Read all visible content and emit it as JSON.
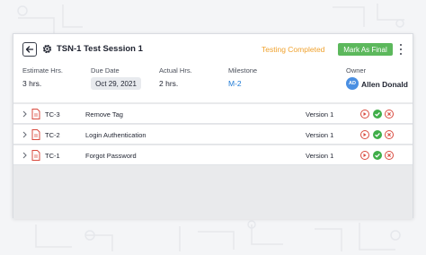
{
  "session": {
    "title": "TSN-1 Test Session 1",
    "status": "Testing Completed",
    "final_button": "Mark As Final"
  },
  "meta": {
    "estimate": {
      "label": "Estimate Hrs.",
      "value": "3 hrs."
    },
    "due": {
      "label": "Due Date",
      "value": "Oct 29, 2021"
    },
    "actual": {
      "label": "Actual Hrs.",
      "value": "2 hrs."
    },
    "milestone": {
      "label": "Milestone",
      "value": "M-2"
    },
    "owner": {
      "label": "Owner",
      "initials": "AD",
      "name": "Allen Donald"
    }
  },
  "test_cases": [
    {
      "id": "TC-3",
      "name": "Remove Tag",
      "version": "Version 1"
    },
    {
      "id": "TC-2",
      "name": "Login Authentication",
      "version": "Version 1"
    },
    {
      "id": "TC-1",
      "name": "Forgot Password",
      "version": "Version 1"
    }
  ],
  "colors": {
    "status": "#f0a22e",
    "final_button": "#5cb85c",
    "milestone": "#1f7bd6",
    "pass": "#3fae49",
    "fail": "#d94b3f"
  },
  "icons": [
    "back-arrow-icon",
    "gear-icon",
    "kebab-menu-icon",
    "chevron-right-icon",
    "file-icon",
    "play-icon",
    "check-icon",
    "close-icon"
  ]
}
